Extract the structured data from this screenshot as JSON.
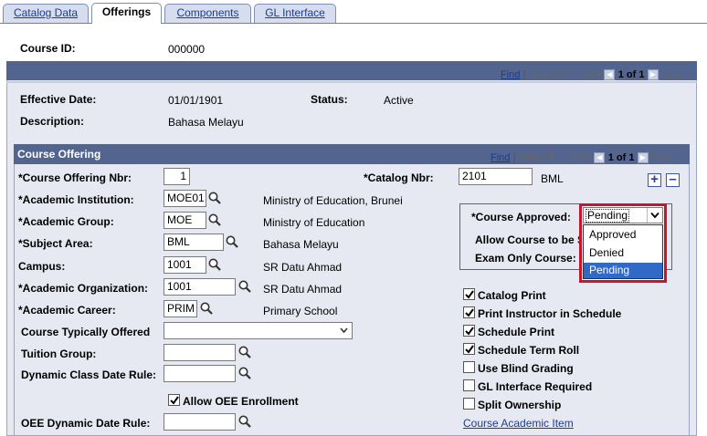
{
  "tabs": [
    {
      "label": "Catalog Data"
    },
    {
      "label": "Offerings"
    },
    {
      "label": "Components"
    },
    {
      "label": "GL Interface"
    }
  ],
  "course": {
    "id_label": "Course ID:",
    "id_value": "000000"
  },
  "effdated": {
    "find": "Find",
    "view_all": "View All",
    "first": "First",
    "pager": "1 of 1",
    "last": "Last",
    "eff_date_label": "Effective Date:",
    "eff_date_value": "01/01/1901",
    "status_label": "Status:",
    "status_value": "Active",
    "desc_label": "Description:",
    "desc_value": "Bahasa Melayu"
  },
  "offering": {
    "title": "Course Offering",
    "find": "Find",
    "view_all": "View All",
    "first": "First",
    "pager": "1 of 1",
    "last": "Last",
    "nbr_label": "*Course Offering Nbr:",
    "nbr_value": "1",
    "catalog_label": "*Catalog Nbr:",
    "catalog_value": "2101",
    "catalog_desc": "BML",
    "inst_label": "*Academic Institution:",
    "inst_value": "MOE01",
    "inst_desc": "Ministry of Education, Brunei",
    "group_label": "*Academic Group:",
    "group_value": "MOE",
    "group_desc": "Ministry of Education",
    "subject_label": "*Subject Area:",
    "subject_value": "BML",
    "subject_desc": "Bahasa Melayu",
    "campus_label": "Campus:",
    "campus_value": "1001",
    "campus_desc": "SR Datu Ahmad",
    "org_label": "*Academic Organization:",
    "org_value": "1001",
    "org_desc": "SR Datu Ahmad",
    "career_label": "*Academic Career:",
    "career_value": "PRIM",
    "career_desc": "Primary School",
    "typical_label": "Course Typically Offered",
    "tuition_label": "Tuition Group:",
    "dyn_class_label": "Dynamic Class Date Rule:",
    "oee_enroll_label": "Allow OEE Enrollment",
    "oee_dyn_label": "OEE Dynamic Date Rule:"
  },
  "approval": {
    "label": "*Course Approved:",
    "selected": "Pending",
    "options": [
      "Approved",
      "Denied",
      "Pending"
    ],
    "allow_sched_label": "Allow Course to be S",
    "exam_only_label": "Exam Only Course:"
  },
  "checkboxes": [
    {
      "label": "Catalog Print",
      "checked": true
    },
    {
      "label": "Print Instructor in Schedule",
      "checked": true
    },
    {
      "label": "Schedule Print",
      "checked": true
    },
    {
      "label": "Schedule Term Roll",
      "checked": true
    },
    {
      "label": "Use Blind Grading",
      "checked": false
    },
    {
      "label": "GL Interface Required",
      "checked": false
    },
    {
      "label": "Split Ownership",
      "checked": false
    }
  ],
  "links": {
    "course_academic_item": "Course Academic Item"
  },
  "colors": {
    "header_bar": "#53658f",
    "section_bg": "#e7e9f2",
    "highlight": "#3169c6",
    "dropdown_border": "#d0112b"
  }
}
